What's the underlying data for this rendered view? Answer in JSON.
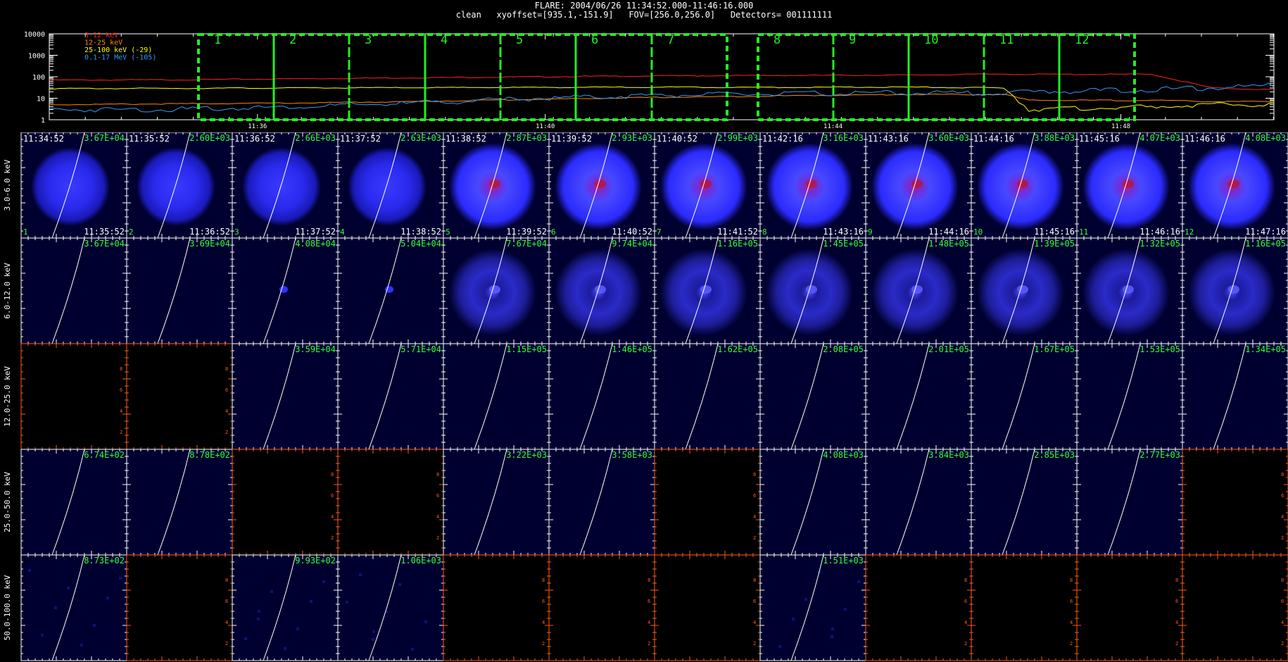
{
  "header": {
    "line1": "FLARE: 2004/06/26 11:34:52.000-11:46:16.000",
    "line2": "clean   xyoffset=[935.1,-151.9]   FOV=[256.0,256.0]   Detectors= 001111111"
  },
  "chart_data": [
    {
      "type": "line",
      "xlabel": "",
      "ylabel": "",
      "yscale": "log",
      "ylim": [
        1,
        10000
      ],
      "ytick_labels": [
        "10000",
        "1000",
        "100",
        "10",
        "1"
      ],
      "xtick_labels": [
        "11:36",
        "11:40",
        "11:44",
        "11:48"
      ],
      "legend_position": "top-left",
      "series": [
        {
          "name": "3-12 keV",
          "color": "#ff2020",
          "x": [
            0,
            0.1,
            0.2,
            0.3,
            0.4,
            0.5,
            0.6,
            0.7,
            0.78,
            0.8,
            0.9,
            0.95,
            1.0
          ],
          "values": [
            70,
            72,
            80,
            90,
            100,
            110,
            115,
            120,
            135,
            130,
            130,
            30,
            25
          ]
        },
        {
          "name": "12-25 keV",
          "color": "#ff8800",
          "x": [
            0,
            0.1,
            0.2,
            0.3,
            0.4,
            0.5,
            0.6,
            0.7,
            0.78,
            0.8,
            0.9,
            0.95,
            1.0
          ],
          "values": [
            5,
            5.5,
            6,
            7,
            9,
            11,
            13,
            15,
            15,
            8,
            8,
            7,
            7
          ]
        },
        {
          "name": "25-100 keV (-29)",
          "color": "#ffff00",
          "x": [
            0,
            0.1,
            0.2,
            0.3,
            0.4,
            0.5,
            0.6,
            0.7,
            0.78,
            0.8,
            0.9,
            0.95,
            1.0
          ],
          "values": [
            28,
            29,
            30,
            31,
            32,
            33,
            32,
            33,
            30,
            3,
            4,
            5,
            5
          ]
        },
        {
          "name": "0.1-17 MeV (-105)",
          "color": "#3399ff",
          "x": [
            0,
            0.1,
            0.2,
            0.3,
            0.4,
            0.5,
            0.6,
            0.7,
            0.78,
            0.8,
            0.9,
            0.95,
            1.0
          ],
          "values": [
            3,
            3,
            4,
            6,
            10,
            14,
            16,
            18,
            17,
            20,
            25,
            30,
            40
          ]
        }
      ],
      "intervals": [
        "1",
        "2",
        "3",
        "4",
        "5",
        "6",
        "7",
        "8",
        "9",
        "10",
        "11",
        "12"
      ]
    }
  ],
  "image_grid": {
    "row_labels": [
      "3.0-6.0 keV",
      "6.0-12.0 keV",
      "12.0-25.0 keV",
      "25.0-50.0 keV",
      "50.0-100.0 keV"
    ],
    "start_times": [
      "11:34:52",
      "11:35:52",
      "11:36:52",
      "11:37:52",
      "11:38:52",
      "11:39:52",
      "11:40:52",
      "11:42:16",
      "11:43:16",
      "11:44:16",
      "11:45:16",
      "11:46:16"
    ],
    "end_times": [
      "11:35:52",
      "11:36:52",
      "11:37:52",
      "11:38:52",
      "11:39:52",
      "11:40:52",
      "11:41:52",
      "11:43:16",
      "11:44:16",
      "11:45:16",
      "11:46:16",
      "11:47:16"
    ],
    "interval_numbers": [
      "1",
      "2",
      "3",
      "4",
      "5",
      "6",
      "7",
      "8",
      "9",
      "10",
      "11",
      "12"
    ],
    "peak_labels": [
      [
        "3.67E+04",
        "2.60E+03",
        "2.66E+03",
        "2.63E+03",
        "2.87E+03",
        "2.93E+03",
        "2.99E+03",
        "3.16E+03",
        "3.60E+03",
        "3.88E+03",
        "4.07E+03",
        "4.08E+03"
      ],
      [
        "3.67E+04",
        "3.69E+04",
        "4.08E+04",
        "5.04E+04",
        "7.67E+04",
        "9.74E+04",
        "1.16E+05",
        "1.45E+05",
        "1.48E+05",
        "1.39E+05",
        "1.32E+05",
        "1.16E+05"
      ],
      [
        "",
        "",
        "3.59E+04",
        "5.71E+04",
        "1.15E+05",
        "1.46E+05",
        "1.62E+05",
        "2.08E+05",
        "2.01E+05",
        "1.67E+05",
        "1.53E+05",
        "1.34E+05"
      ],
      [
        "6.74E+02",
        "8.78E+02",
        "",
        "",
        "3.22E+03",
        "3.58E+03",
        "",
        "4.08E+03",
        "3.84E+03",
        "2.85E+03",
        "2.77E+03",
        ""
      ],
      [
        "8.73E+02",
        "",
        "9.93E+02",
        "1.06E+03",
        "",
        "",
        "",
        "1.51E+03",
        "",
        "",
        "",
        ""
      ]
    ],
    "cell_kind": [
      [
        "disk",
        "disk",
        "disk",
        "disk",
        "bright",
        "bright",
        "bright",
        "bright",
        "bright",
        "bright",
        "bright",
        "bright"
      ],
      [
        "faint",
        "faint",
        "faint",
        "faint",
        "ring",
        "ring",
        "ring",
        "ring",
        "ring",
        "ring",
        "ring",
        "ring"
      ],
      [
        "empty",
        "empty",
        "faint",
        "faint",
        "faint",
        "faint",
        "faint",
        "faint",
        "faint",
        "faint",
        "faint",
        "faint"
      ],
      [
        "faint",
        "faint",
        "empty",
        "empty",
        "faint",
        "faint",
        "empty",
        "faint",
        "faint",
        "faint",
        "faint",
        "empty"
      ],
      [
        "faint",
        "empty",
        "faint",
        "faint",
        "empty",
        "empty",
        "empty",
        "faint",
        "empty",
        "empty",
        "empty",
        "empty"
      ]
    ],
    "empty_axis_ticks": [
      "2",
      "4",
      "6",
      "8"
    ],
    "colors": {
      "label_green": "#33ff33",
      "interval_box": "#22ee22",
      "empty_axes": "#ff5a1a",
      "limb": "#ffffff",
      "cell_bg": "#000030"
    }
  }
}
